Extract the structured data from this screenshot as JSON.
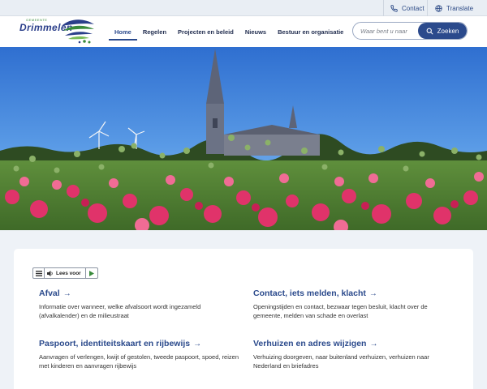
{
  "topbar": {
    "contact_label": "Contact",
    "translate_label": "Translate"
  },
  "logo": {
    "small_text": "GEMEENTE",
    "name": "Drimmelen"
  },
  "nav": {
    "items": [
      "Home",
      "Regelen",
      "Projecten en beleid",
      "Nieuws",
      "Bestuur en organisatie"
    ],
    "active": "Home"
  },
  "search": {
    "placeholder": "Waar bent u naar",
    "button_label": "Zoeken"
  },
  "readspeaker": {
    "label": "Lees voor"
  },
  "blocks": [
    {
      "title": "Afval",
      "description": "Informatie over wanneer, welke afvalsoort wordt ingezameld (afvalkalender) en de milieustraat"
    },
    {
      "title": "Contact, iets melden, klacht",
      "description": "Openingstijden en contact, bezwaar tegen besluit, klacht over de gemeente, melden van schade en overlast"
    },
    {
      "title": "Paspoort, identiteitskaart en rijbewijs",
      "description": "Aanvragen of verlengen, kwijt of gestolen, tweede paspoort, spoed, reizen met kinderen en aanvragen rijbewijs"
    },
    {
      "title": "Verhuizen en adres wijzigen",
      "description": "Verhuizing doorgeven, naar buitenland verhuizen, verhuizen naar Nederland en briefadres"
    }
  ],
  "colors": {
    "brand_blue": "#2b4a8c",
    "page_background": "#eef2f7",
    "topbar_background": "#e9eef4",
    "logo_green": "#3a8b3c"
  },
  "icons": {
    "contact": "phone-icon",
    "translate": "globe-icon",
    "search": "search-icon",
    "link_arrow": "arrow-right-icon",
    "readspeaker_menu": "menu-icon",
    "readspeaker_speaker": "speaker-icon",
    "readspeaker_play": "play-icon"
  }
}
